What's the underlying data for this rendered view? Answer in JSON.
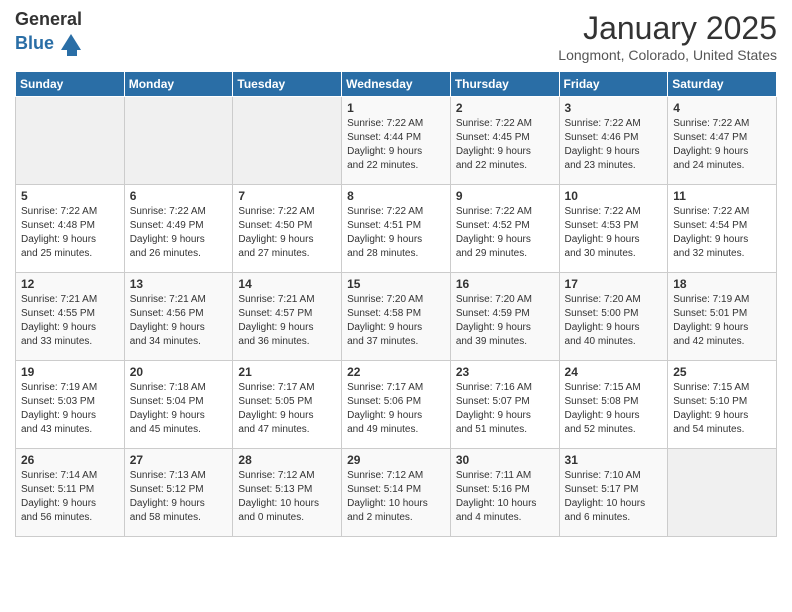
{
  "header": {
    "logo_general": "General",
    "logo_blue": "Blue",
    "title": "January 2025",
    "subtitle": "Longmont, Colorado, United States"
  },
  "days_of_week": [
    "Sunday",
    "Monday",
    "Tuesday",
    "Wednesday",
    "Thursday",
    "Friday",
    "Saturday"
  ],
  "weeks": [
    [
      {
        "day": "",
        "info": ""
      },
      {
        "day": "",
        "info": ""
      },
      {
        "day": "",
        "info": ""
      },
      {
        "day": "1",
        "info": "Sunrise: 7:22 AM\nSunset: 4:44 PM\nDaylight: 9 hours\nand 22 minutes."
      },
      {
        "day": "2",
        "info": "Sunrise: 7:22 AM\nSunset: 4:45 PM\nDaylight: 9 hours\nand 22 minutes."
      },
      {
        "day": "3",
        "info": "Sunrise: 7:22 AM\nSunset: 4:46 PM\nDaylight: 9 hours\nand 23 minutes."
      },
      {
        "day": "4",
        "info": "Sunrise: 7:22 AM\nSunset: 4:47 PM\nDaylight: 9 hours\nand 24 minutes."
      }
    ],
    [
      {
        "day": "5",
        "info": "Sunrise: 7:22 AM\nSunset: 4:48 PM\nDaylight: 9 hours\nand 25 minutes."
      },
      {
        "day": "6",
        "info": "Sunrise: 7:22 AM\nSunset: 4:49 PM\nDaylight: 9 hours\nand 26 minutes."
      },
      {
        "day": "7",
        "info": "Sunrise: 7:22 AM\nSunset: 4:50 PM\nDaylight: 9 hours\nand 27 minutes."
      },
      {
        "day": "8",
        "info": "Sunrise: 7:22 AM\nSunset: 4:51 PM\nDaylight: 9 hours\nand 28 minutes."
      },
      {
        "day": "9",
        "info": "Sunrise: 7:22 AM\nSunset: 4:52 PM\nDaylight: 9 hours\nand 29 minutes."
      },
      {
        "day": "10",
        "info": "Sunrise: 7:22 AM\nSunset: 4:53 PM\nDaylight: 9 hours\nand 30 minutes."
      },
      {
        "day": "11",
        "info": "Sunrise: 7:22 AM\nSunset: 4:54 PM\nDaylight: 9 hours\nand 32 minutes."
      }
    ],
    [
      {
        "day": "12",
        "info": "Sunrise: 7:21 AM\nSunset: 4:55 PM\nDaylight: 9 hours\nand 33 minutes."
      },
      {
        "day": "13",
        "info": "Sunrise: 7:21 AM\nSunset: 4:56 PM\nDaylight: 9 hours\nand 34 minutes."
      },
      {
        "day": "14",
        "info": "Sunrise: 7:21 AM\nSunset: 4:57 PM\nDaylight: 9 hours\nand 36 minutes."
      },
      {
        "day": "15",
        "info": "Sunrise: 7:20 AM\nSunset: 4:58 PM\nDaylight: 9 hours\nand 37 minutes."
      },
      {
        "day": "16",
        "info": "Sunrise: 7:20 AM\nSunset: 4:59 PM\nDaylight: 9 hours\nand 39 minutes."
      },
      {
        "day": "17",
        "info": "Sunrise: 7:20 AM\nSunset: 5:00 PM\nDaylight: 9 hours\nand 40 minutes."
      },
      {
        "day": "18",
        "info": "Sunrise: 7:19 AM\nSunset: 5:01 PM\nDaylight: 9 hours\nand 42 minutes."
      }
    ],
    [
      {
        "day": "19",
        "info": "Sunrise: 7:19 AM\nSunset: 5:03 PM\nDaylight: 9 hours\nand 43 minutes."
      },
      {
        "day": "20",
        "info": "Sunrise: 7:18 AM\nSunset: 5:04 PM\nDaylight: 9 hours\nand 45 minutes."
      },
      {
        "day": "21",
        "info": "Sunrise: 7:17 AM\nSunset: 5:05 PM\nDaylight: 9 hours\nand 47 minutes."
      },
      {
        "day": "22",
        "info": "Sunrise: 7:17 AM\nSunset: 5:06 PM\nDaylight: 9 hours\nand 49 minutes."
      },
      {
        "day": "23",
        "info": "Sunrise: 7:16 AM\nSunset: 5:07 PM\nDaylight: 9 hours\nand 51 minutes."
      },
      {
        "day": "24",
        "info": "Sunrise: 7:15 AM\nSunset: 5:08 PM\nDaylight: 9 hours\nand 52 minutes."
      },
      {
        "day": "25",
        "info": "Sunrise: 7:15 AM\nSunset: 5:10 PM\nDaylight: 9 hours\nand 54 minutes."
      }
    ],
    [
      {
        "day": "26",
        "info": "Sunrise: 7:14 AM\nSunset: 5:11 PM\nDaylight: 9 hours\nand 56 minutes."
      },
      {
        "day": "27",
        "info": "Sunrise: 7:13 AM\nSunset: 5:12 PM\nDaylight: 9 hours\nand 58 minutes."
      },
      {
        "day": "28",
        "info": "Sunrise: 7:12 AM\nSunset: 5:13 PM\nDaylight: 10 hours\nand 0 minutes."
      },
      {
        "day": "29",
        "info": "Sunrise: 7:12 AM\nSunset: 5:14 PM\nDaylight: 10 hours\nand 2 minutes."
      },
      {
        "day": "30",
        "info": "Sunrise: 7:11 AM\nSunset: 5:16 PM\nDaylight: 10 hours\nand 4 minutes."
      },
      {
        "day": "31",
        "info": "Sunrise: 7:10 AM\nSunset: 5:17 PM\nDaylight: 10 hours\nand 6 minutes."
      },
      {
        "day": "",
        "info": ""
      }
    ]
  ]
}
